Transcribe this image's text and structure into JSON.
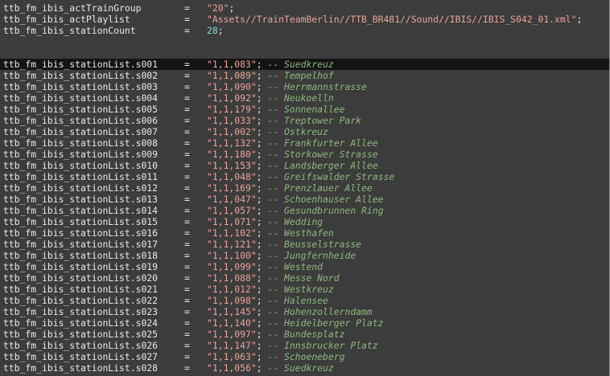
{
  "editor": {
    "header_lines": [
      {
        "key": "ttb_fm_ibis_actTrainGroup",
        "eq": "=",
        "string": "\"20\"",
        "number": "",
        "semi": ";"
      },
      {
        "key": "ttb_fm_ibis_actPlaylist",
        "eq": "=",
        "string": "\"Assets//TrainTeamBerlin//TTB_BR481//Sound//IBIS//IBIS_S042_01.xml\"",
        "number": "",
        "semi": ";"
      },
      {
        "key": "ttb_fm_ibis_stationCount",
        "eq": "=",
        "string": "",
        "number": "28",
        "semi": ";"
      }
    ],
    "station_lines": [
      {
        "key": "ttb_fm_ibis_stationList.s001",
        "eq": "=",
        "value": "\"1,1,083\"",
        "semi": ";",
        "comment": "-- Suedkreuz"
      },
      {
        "key": "ttb_fm_ibis_stationList.s002",
        "eq": "=",
        "value": "\"1,1,089\"",
        "semi": ";",
        "comment": "-- Tempelhof"
      },
      {
        "key": "ttb_fm_ibis_stationList.s003",
        "eq": "=",
        "value": "\"1,1,090\"",
        "semi": ";",
        "comment": "-- Herrmannstrasse"
      },
      {
        "key": "ttb_fm_ibis_stationList.s004",
        "eq": "=",
        "value": "\"1,1,092\"",
        "semi": ";",
        "comment": "-- Neukoelln"
      },
      {
        "key": "ttb_fm_ibis_stationList.s005",
        "eq": "=",
        "value": "\"1,1,179\"",
        "semi": ";",
        "comment": "-- Sonnenallee"
      },
      {
        "key": "ttb_fm_ibis_stationList.s006",
        "eq": "=",
        "value": "\"1,1,033\"",
        "semi": ";",
        "comment": "-- Treptower Park"
      },
      {
        "key": "ttb_fm_ibis_stationList.s007",
        "eq": "=",
        "value": "\"1,1,002\"",
        "semi": ";",
        "comment": "-- Ostkreuz"
      },
      {
        "key": "ttb_fm_ibis_stationList.s008",
        "eq": "=",
        "value": "\"1,1,132\"",
        "semi": ";",
        "comment": "-- Frankfurter Allee"
      },
      {
        "key": "ttb_fm_ibis_stationList.s009",
        "eq": "=",
        "value": "\"1,1,180\"",
        "semi": ";",
        "comment": "-- Storkower Strasse"
      },
      {
        "key": "ttb_fm_ibis_stationList.s010",
        "eq": "=",
        "value": "\"1,1,153\"",
        "semi": ";",
        "comment": "-- Landsberger Allee"
      },
      {
        "key": "ttb_fm_ibis_stationList.s011",
        "eq": "=",
        "value": "\"1,1,048\"",
        "semi": ";",
        "comment": "-- Greifswalder Strasse"
      },
      {
        "key": "ttb_fm_ibis_stationList.s012",
        "eq": "=",
        "value": "\"1,1,169\"",
        "semi": ";",
        "comment": "-- Prenzlauer Allee"
      },
      {
        "key": "ttb_fm_ibis_stationList.s013",
        "eq": "=",
        "value": "\"1,1,047\"",
        "semi": ";",
        "comment": "-- Schoenhauser Allee"
      },
      {
        "key": "ttb_fm_ibis_stationList.s014",
        "eq": "=",
        "value": "\"1,1,057\"",
        "semi": ";",
        "comment": "-- Gesundbrunnen Ring"
      },
      {
        "key": "ttb_fm_ibis_stationList.s015",
        "eq": "=",
        "value": "\"1,1,071\"",
        "semi": ";",
        "comment": "-- Wedding"
      },
      {
        "key": "ttb_fm_ibis_stationList.s016",
        "eq": "=",
        "value": "\"1,1,102\"",
        "semi": ";",
        "comment": "-- Westhafen"
      },
      {
        "key": "ttb_fm_ibis_stationList.s017",
        "eq": "=",
        "value": "\"1,1,121\"",
        "semi": ";",
        "comment": "-- Beusselstrasse"
      },
      {
        "key": "ttb_fm_ibis_stationList.s018",
        "eq": "=",
        "value": "\"1,1,100\"",
        "semi": ";",
        "comment": "-- Jungfernheide"
      },
      {
        "key": "ttb_fm_ibis_stationList.s019",
        "eq": "=",
        "value": "\"1,1,099\"",
        "semi": ";",
        "comment": "-- Westend"
      },
      {
        "key": "ttb_fm_ibis_stationList.s020",
        "eq": "=",
        "value": "\"1,1,088\"",
        "semi": ";",
        "comment": "-- Messe Nord"
      },
      {
        "key": "ttb_fm_ibis_stationList.s021",
        "eq": "=",
        "value": "\"1,1,012\"",
        "semi": ";",
        "comment": "-- Westkreuz"
      },
      {
        "key": "ttb_fm_ibis_stationList.s022",
        "eq": "=",
        "value": "\"1,1,098\"",
        "semi": ";",
        "comment": "-- Halensee"
      },
      {
        "key": "ttb_fm_ibis_stationList.s023",
        "eq": "=",
        "value": "\"1,1,145\"",
        "semi": ";",
        "comment": "-- Hohenzollerndamm"
      },
      {
        "key": "ttb_fm_ibis_stationList.s024",
        "eq": "=",
        "value": "\"1,1,140\"",
        "semi": ";",
        "comment": "-- Heidelberger Platz"
      },
      {
        "key": "ttb_fm_ibis_stationList.s025",
        "eq": "=",
        "value": "\"1,1,097\"",
        "semi": ";",
        "comment": "-- Bundesplatz"
      },
      {
        "key": "ttb_fm_ibis_stationList.s026",
        "eq": "=",
        "value": "\"1,1,147\"",
        "semi": ";",
        "comment": "-- Innsbrucker Platz"
      },
      {
        "key": "ttb_fm_ibis_stationList.s027",
        "eq": "=",
        "value": "\"1,1,063\"",
        "semi": ";",
        "comment": "-- Schoeneberg"
      },
      {
        "key": "ttb_fm_ibis_stationList.s028",
        "eq": "=",
        "value": "\"1,1,056\"",
        "semi": ";",
        "comment": "-- Suedkreuz"
      }
    ]
  },
  "colors": {
    "background": "#3c3c3c",
    "current_line": "#141414",
    "string": "#e9a39c",
    "number": "#8fd5d5",
    "comment": "#8fb67f",
    "text": "#e8e8e8"
  }
}
